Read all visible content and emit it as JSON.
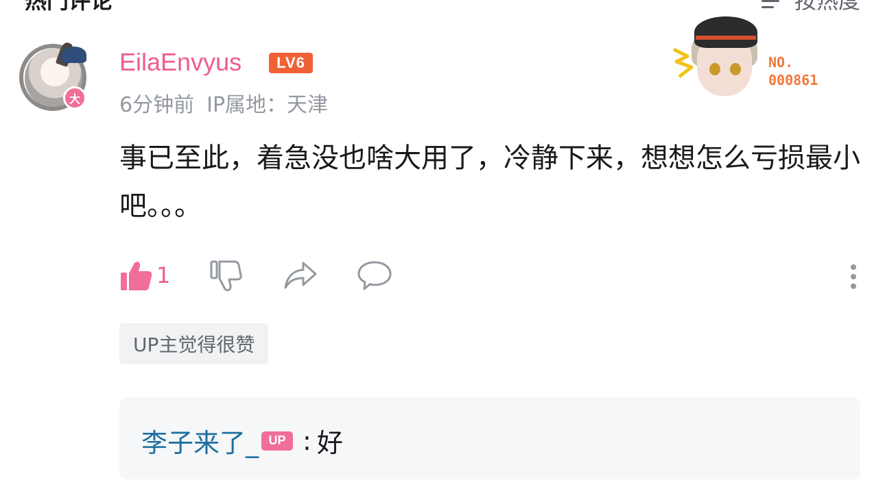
{
  "header": {
    "section_title": "热门评论",
    "sort_label": "按热度"
  },
  "comment": {
    "avatar_badge": "大",
    "username": "EilaEnvyus",
    "level_badge": "LV6",
    "time": "6分钟前",
    "ip_location": "IP属地：天津",
    "decoration_number_prefix": "NO.",
    "decoration_number": "000861",
    "text": "事已至此，着急没也啥大用了，冷静下来，想想怎么亏损最小吧。。。",
    "like_count": "1",
    "up_liked_tag": "UP主觉得很赞"
  },
  "reply": {
    "username": "李子来了_",
    "up_badge": "UP",
    "colon": ":",
    "text": "好"
  },
  "colors": {
    "username_pink": "#ee5b8f",
    "level_orange": "#f06236",
    "reply_user_blue": "#1e6fa0",
    "meta_gray": "#9499a0"
  }
}
